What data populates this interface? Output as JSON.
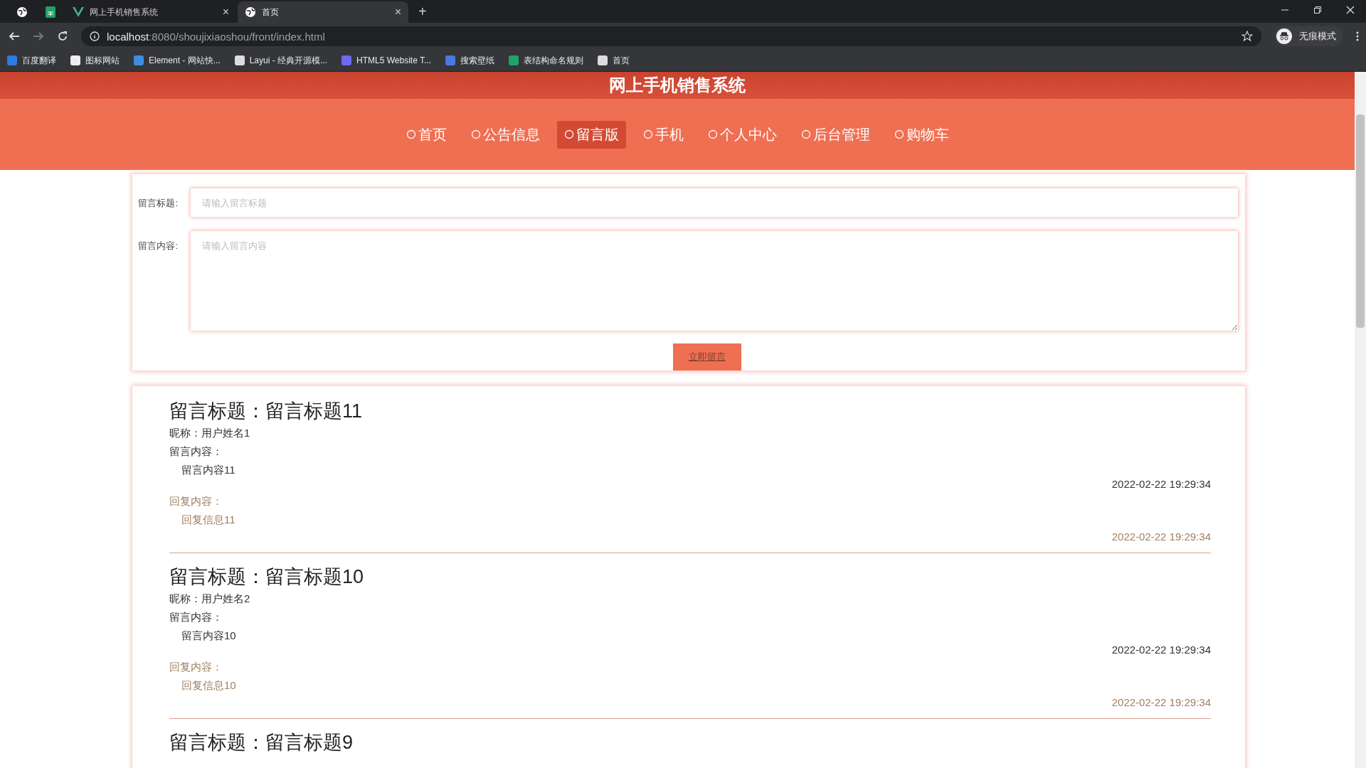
{
  "browser": {
    "tabs": [
      {
        "kind": "pinned",
        "selected": false
      },
      {
        "kind": "pinned",
        "selected": false
      },
      {
        "kind": "page",
        "title": "网上手机销售系统",
        "close": "×",
        "selected": false
      },
      {
        "kind": "page",
        "title": "首页",
        "close": "×",
        "selected": true
      }
    ],
    "new_tab": "+",
    "address": {
      "host": "localhost",
      "path": ":8080/shoujixiaoshou/front/index.html"
    },
    "incognito": "无痕模式",
    "bookmarks": [
      "百度翻译",
      "图标网站",
      "Element - 网站快...",
      "Layui - 经典开源模...",
      "HTML5 Website T...",
      "搜索壁纸",
      "表结构命名规则",
      "首页"
    ]
  },
  "site_title": "网上手机销售系统",
  "nav": [
    {
      "label": "首页",
      "selected": false
    },
    {
      "label": "公告信息",
      "selected": false
    },
    {
      "label": "留言版",
      "selected": true
    },
    {
      "label": "手机",
      "selected": false
    },
    {
      "label": "个人中心",
      "selected": false
    },
    {
      "label": "后台管理",
      "selected": false
    },
    {
      "label": "购物车",
      "selected": false
    }
  ],
  "form": {
    "fields": [
      {
        "kind": "input",
        "label": "留言标题:",
        "placeholder": "请输入留言标题"
      },
      {
        "kind": "textarea",
        "label": "留言内容:",
        "placeholder": "请输入留言内容"
      }
    ],
    "submit": "立即留言"
  },
  "messages": [
    {
      "title": "留言标题：留言标题11",
      "nickname": "昵称：用户姓名1",
      "content_label": "留言内容：",
      "content": "留言内容11",
      "date": "2022-02-22 19:29:34",
      "reply_label": "回复内容：",
      "reply": "回复信息11",
      "reply_date": "2022-02-22 19:29:34"
    },
    {
      "title": "留言标题：留言标题10",
      "nickname": "昵称：用户姓名2",
      "content_label": "留言内容：",
      "content": "留言内容10",
      "date": "2022-02-22 19:29:34",
      "reply_label": "回复内容：",
      "reply": "回复信息10",
      "reply_date": "2022-02-22 19:29:34"
    },
    {
      "title": "留言标题：留言标题9"
    }
  ]
}
